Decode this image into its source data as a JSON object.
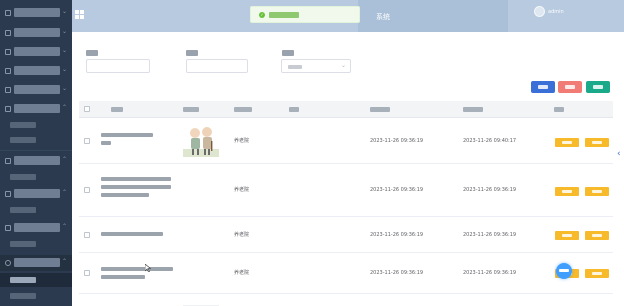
{
  "colors": {
    "sidebar_bg": "#2b3a4e",
    "header_bg": "#b7cadf",
    "search_button": "#3a6fd8",
    "delete_button": "#f07c75",
    "add_button": "#1aaa8a",
    "row_button": "#f7ba2a",
    "toast_icon": "#67c23a"
  },
  "header": {
    "menu_icon": "grid-icon",
    "brand_text": "系统",
    "user_name": "admin",
    "user_icon": "avatar-icon"
  },
  "toast": {
    "icon": "check-circle-icon",
    "message": ""
  },
  "sidebar": {
    "items": [
      {
        "label": "",
        "icon": "folder-icon",
        "expanded": false
      },
      {
        "label": "",
        "icon": "folder-icon",
        "expanded": false
      },
      {
        "label": "",
        "icon": "folder-icon",
        "expanded": false
      },
      {
        "label": "",
        "icon": "folder-icon",
        "expanded": false
      },
      {
        "label": "",
        "icon": "folder-icon",
        "expanded": false
      },
      {
        "label": "",
        "icon": "folder-icon",
        "expanded": true,
        "children": [
          {
            "label": ""
          },
          {
            "label": ""
          }
        ]
      },
      {
        "label": "",
        "icon": "folder-icon",
        "expanded": true,
        "children": [
          {
            "label": ""
          }
        ]
      },
      {
        "label": "",
        "icon": "folder-icon",
        "expanded": true,
        "children": [
          {
            "label": ""
          }
        ]
      },
      {
        "label": "",
        "icon": "folder-icon",
        "expanded": true,
        "children": [
          {
            "label": ""
          }
        ]
      },
      {
        "label": "",
        "icon": "gear-icon",
        "expanded": true,
        "children": [
          {
            "label": "",
            "active": true
          },
          {
            "label": ""
          }
        ]
      }
    ]
  },
  "search": {
    "field1_label": "",
    "field2_label": "",
    "select_label": "",
    "select_value": "",
    "select_icon": "chevron-down-icon"
  },
  "actions": {
    "search_label": "",
    "delete_label": "",
    "add_label": ""
  },
  "table": {
    "columns": [
      "",
      "",
      "",
      "",
      "",
      "",
      ""
    ],
    "rows": [
      {
        "image": "elderly-illustration",
        "category": "养老院",
        "created": "2023-11-26 09:36:19",
        "updated": "2023-11-26 09:40:17",
        "buttons": [
          "",
          ""
        ]
      },
      {
        "image": "",
        "category": "养老院",
        "created": "2023-11-26 09:36:19",
        "updated": "2023-11-26 09:36:19",
        "buttons": [
          "",
          ""
        ]
      },
      {
        "image": "",
        "category": "养老院",
        "created": "2023-11-26 09:36:19",
        "updated": "2023-11-26 09:36:19",
        "buttons": [
          "",
          ""
        ]
      },
      {
        "image": "",
        "category": "养老院",
        "created": "2023-11-26 09:36:19",
        "updated": "2023-11-26 09:36:19",
        "buttons": [
          "",
          ""
        ]
      },
      {
        "image": "elderly-illustration",
        "category": "",
        "created": "",
        "updated": "",
        "buttons": []
      }
    ]
  },
  "floating": {
    "chat_icon": "chat-icon",
    "side_handle_icon": "chevron-left-icon",
    "cursor_icon": "pointer-icon"
  }
}
